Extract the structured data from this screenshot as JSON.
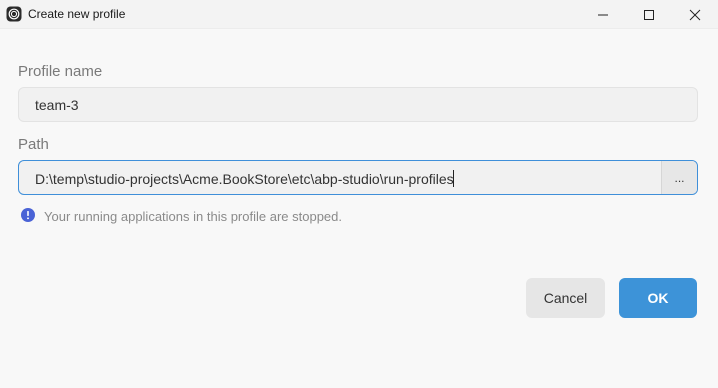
{
  "window": {
    "title": "Create new profile",
    "icon": "abp-studio-logo-icon",
    "controls": [
      "minimize-icon",
      "maximize-icon",
      "close-icon"
    ]
  },
  "form": {
    "profile_name": {
      "label": "Profile name",
      "value": "team-3"
    },
    "path": {
      "label": "Path",
      "value": "D:\\temp\\studio-projects\\Acme.BookStore\\etc\\abp-studio\\run-profiles",
      "browse_label": "..."
    },
    "info": {
      "icon": "info-circle-icon",
      "text": "Your running applications in this profile are stopped."
    }
  },
  "buttons": {
    "cancel_label": "Cancel",
    "ok_label": "OK"
  },
  "colors": {
    "accent": "#3d93d8",
    "info_icon": "#4a63d6",
    "background": "#f8f8f8"
  }
}
